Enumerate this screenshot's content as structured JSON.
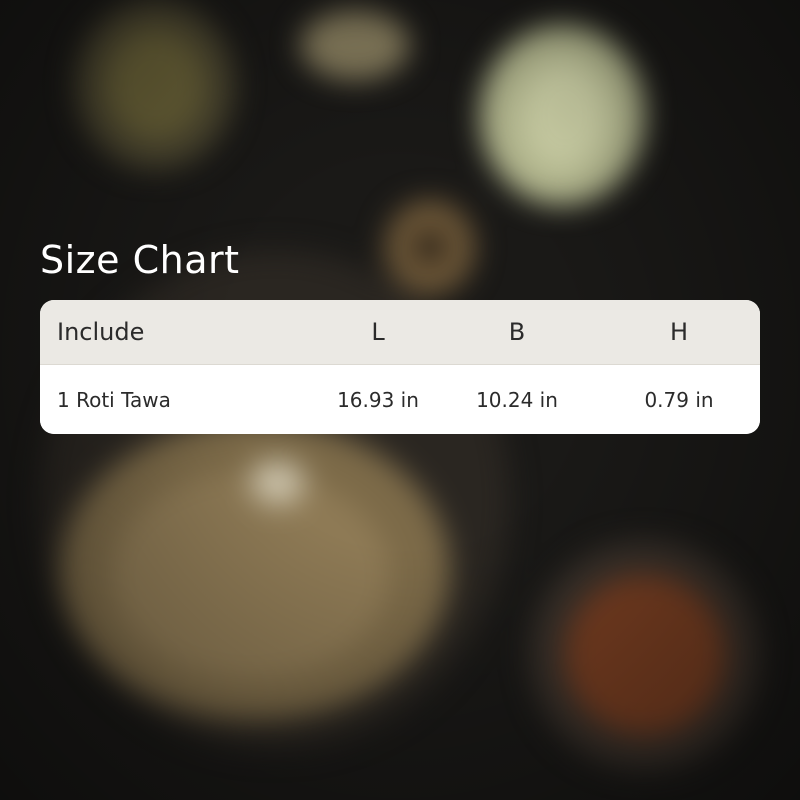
{
  "title": "Size Chart",
  "table": {
    "headers": [
      "Include",
      "L",
      "B",
      "H"
    ],
    "rows": [
      [
        "1 Roti Tawa",
        "16.93 in",
        "10.24 in",
        "0.79 in"
      ]
    ]
  },
  "colors": {
    "header_bg": "#ebe9e4",
    "row_bg": "#ffffff",
    "text": "#2b2b2b",
    "title": "#ffffff"
  }
}
